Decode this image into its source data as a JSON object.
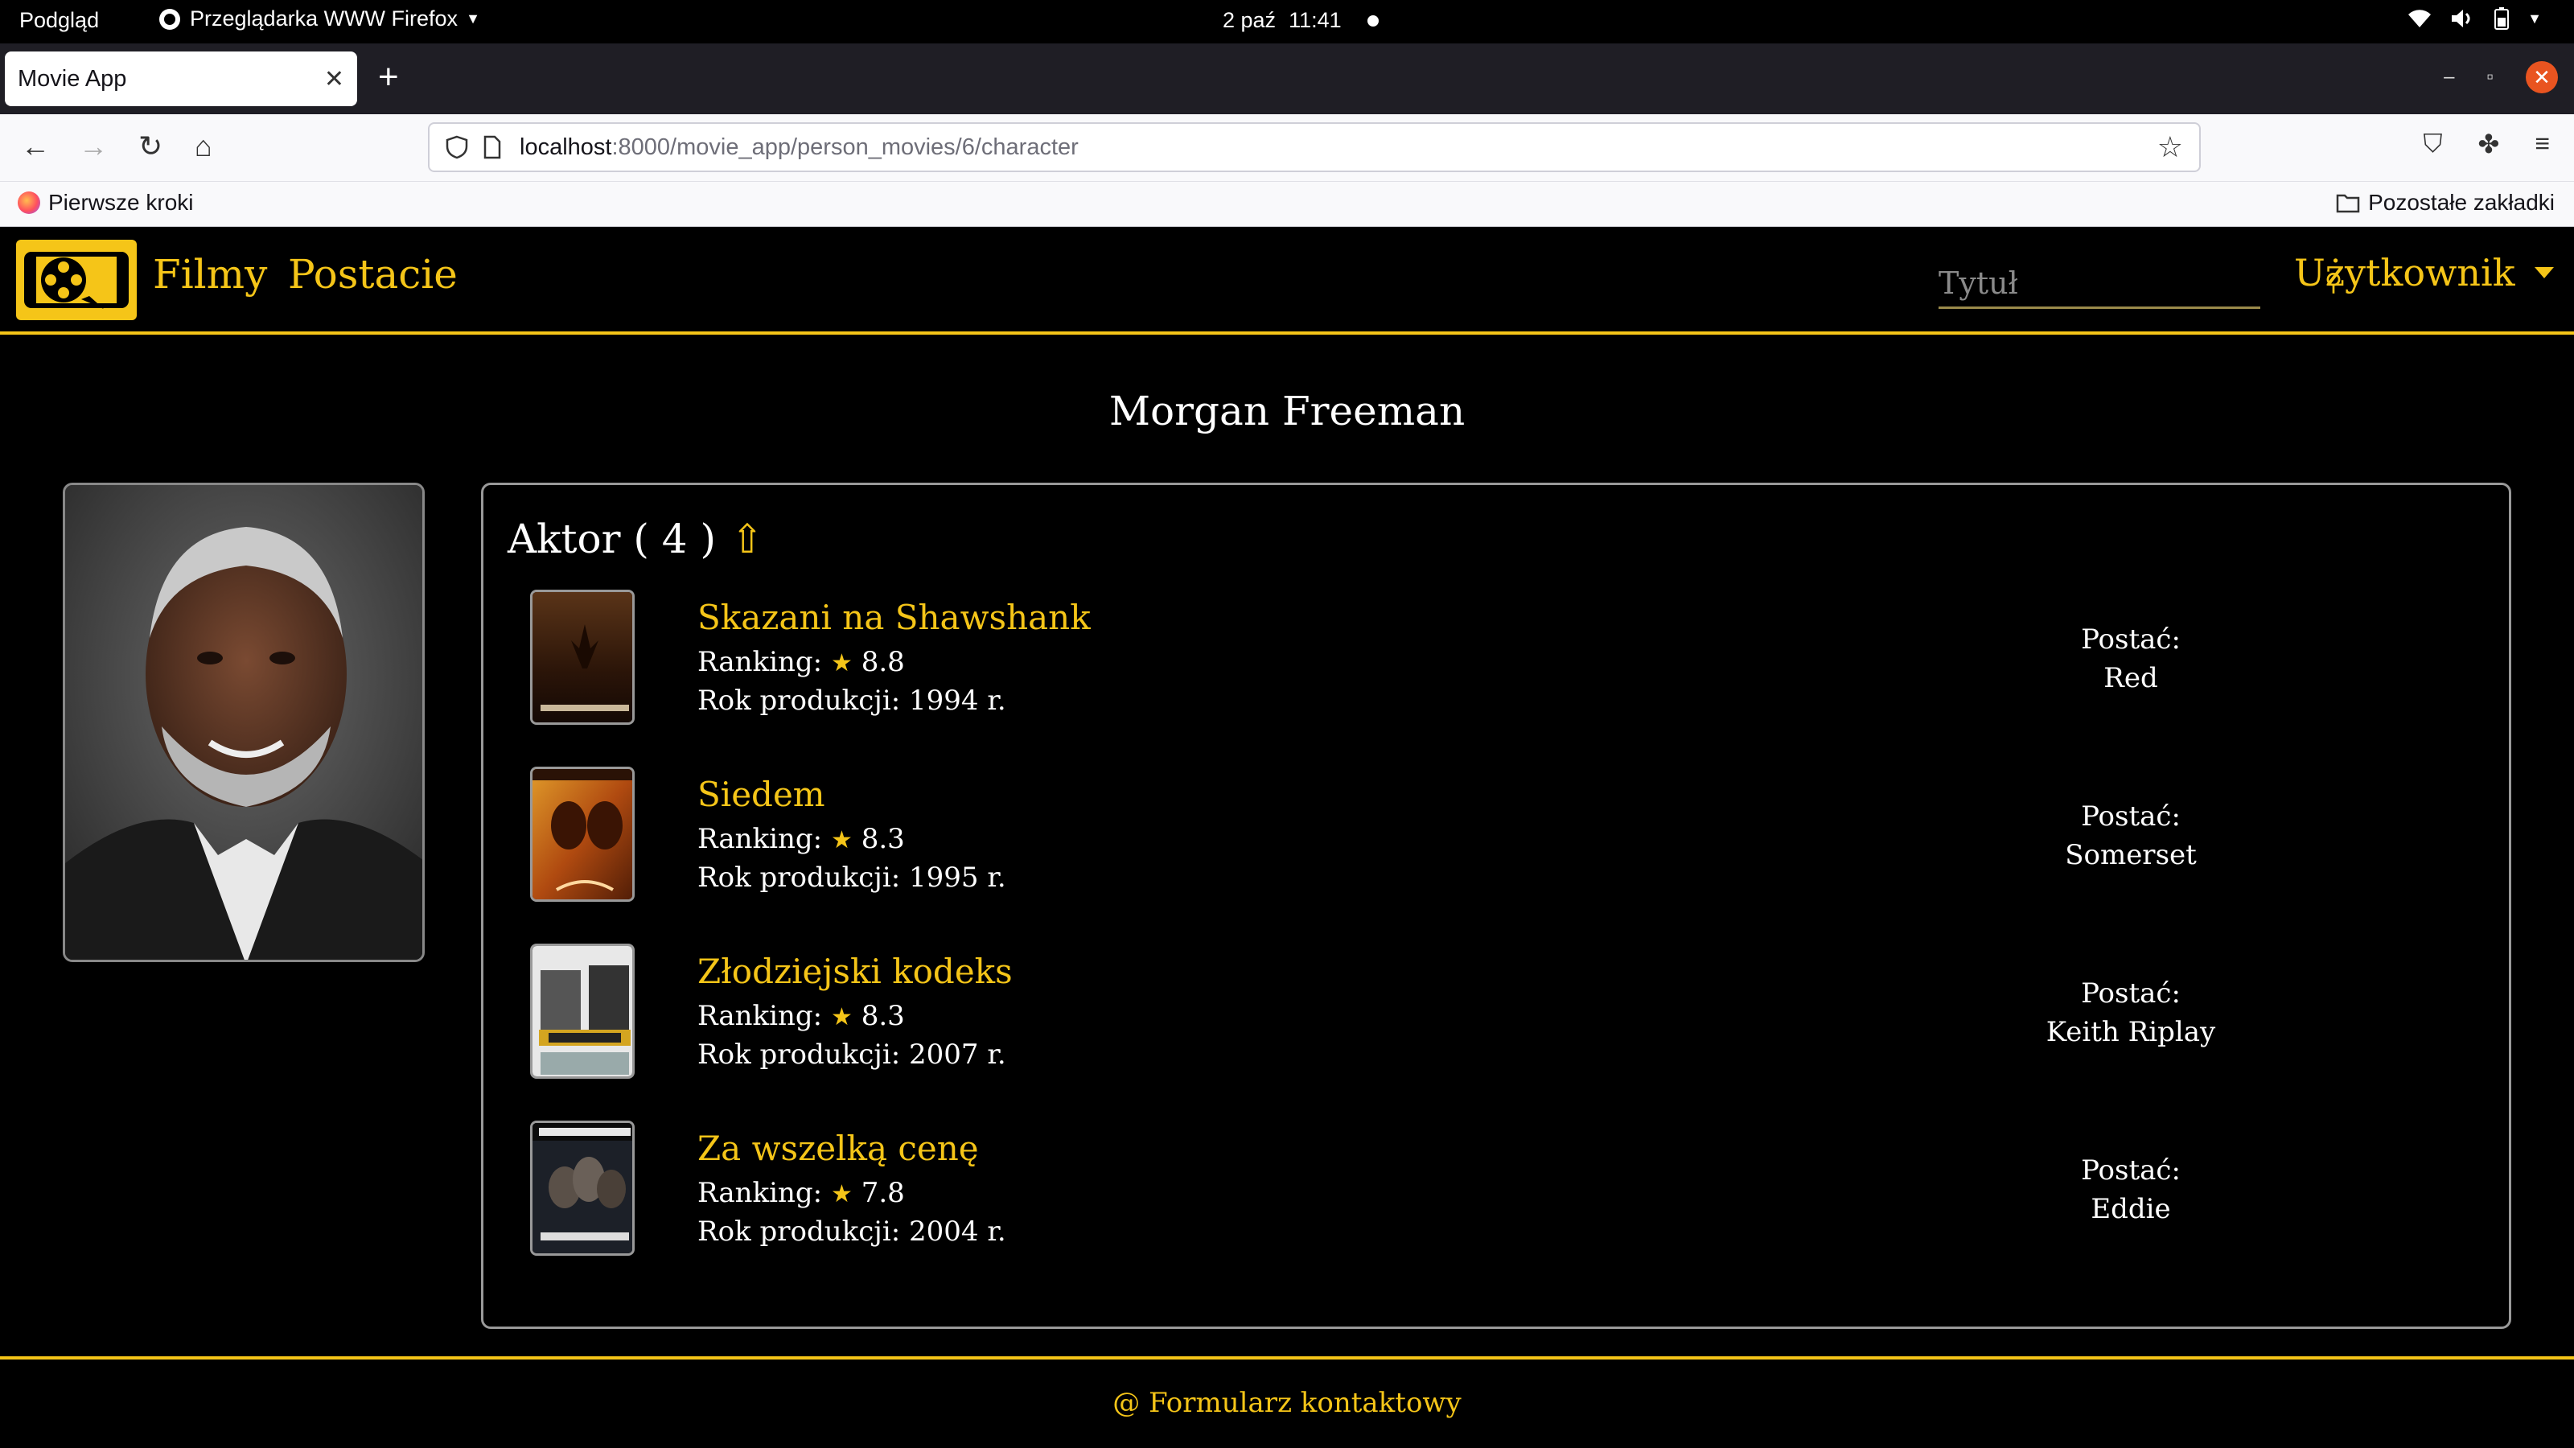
{
  "os_bar": {
    "activities": "Podgląd",
    "app_name": "Przeglądarka WWW Firefox",
    "date": "2 paź",
    "time": "11:41"
  },
  "browser": {
    "tab_title": "Movie App",
    "url_host": "localhost",
    "url_path": ":8000/movie_app/person_movies/6/character",
    "bookmark_left": "Pierwsze kroki",
    "bookmark_right": "Pozostałe zakładki"
  },
  "site": {
    "nav": {
      "films": "Filmy",
      "characters": "Postacie"
    },
    "search_placeholder": "Tytuł",
    "user_menu": "Użytkownik",
    "accent_color": "#f5c518"
  },
  "person": {
    "name": "Morgan Freeman"
  },
  "section": {
    "title": "Aktor ( 4 )",
    "sort_arrow": "⇧"
  },
  "labels": {
    "ranking": "Ranking:",
    "year": "Rok produkcji:",
    "year_suffix": "r.",
    "character": "Postać:",
    "star": "★"
  },
  "movies": [
    {
      "title": "Skazani na Shawshank",
      "rating": "8.8",
      "year": "1994",
      "character": "Red"
    },
    {
      "title": "Siedem",
      "rating": "8.3",
      "year": "1995",
      "character": "Somerset"
    },
    {
      "title": "Złodziejski kodeks",
      "rating": "8.3",
      "year": "2007",
      "character": "Keith Riplay"
    },
    {
      "title": "Za wszelką cenę",
      "rating": "7.8",
      "year": "2004",
      "character": "Eddie"
    }
  ],
  "footer": {
    "contact": "@ Formularz kontaktowy"
  }
}
